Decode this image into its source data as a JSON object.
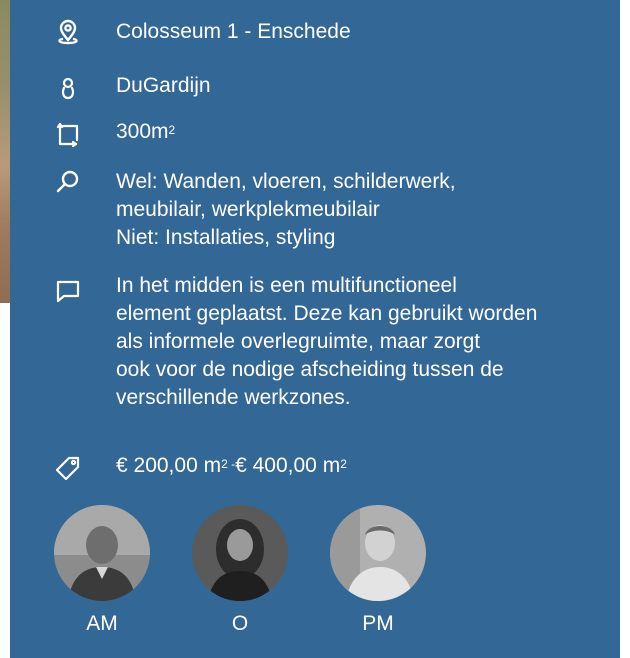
{
  "project": {
    "location": "Colosseum 1 - Enschede",
    "client": "DuGardijn",
    "area_value": "300m",
    "area_unit_sup": "2",
    "scope_lines": [
      "Wel: Wanden, vloeren, schilderwerk,",
      "meubilair, werkplekmeubilair",
      "Niet: Installaties, styling"
    ],
    "description_lines": [
      "In het midden is een multifunctioneel",
      "element geplaatst. Deze kan gebruikt worden",
      "als informele overlegruimte, maar zorgt",
      "ook voor de nodige afscheiding tussen de",
      "verschillende werkzones."
    ],
    "price": {
      "from": "€ 200,00 m",
      "from_sup": "2",
      "separator": " -",
      "to": "€ 400,00 m",
      "to_sup": "2"
    }
  },
  "people": [
    {
      "initials": "AM"
    },
    {
      "initials": "O"
    },
    {
      "initials": "PM"
    }
  ],
  "icons": [
    "location-icon",
    "person-icon",
    "area-icon",
    "search-icon",
    "comment-icon",
    "price-tag-icon"
  ],
  "colors": {
    "panel": "#336795",
    "text": "#ffffff"
  }
}
